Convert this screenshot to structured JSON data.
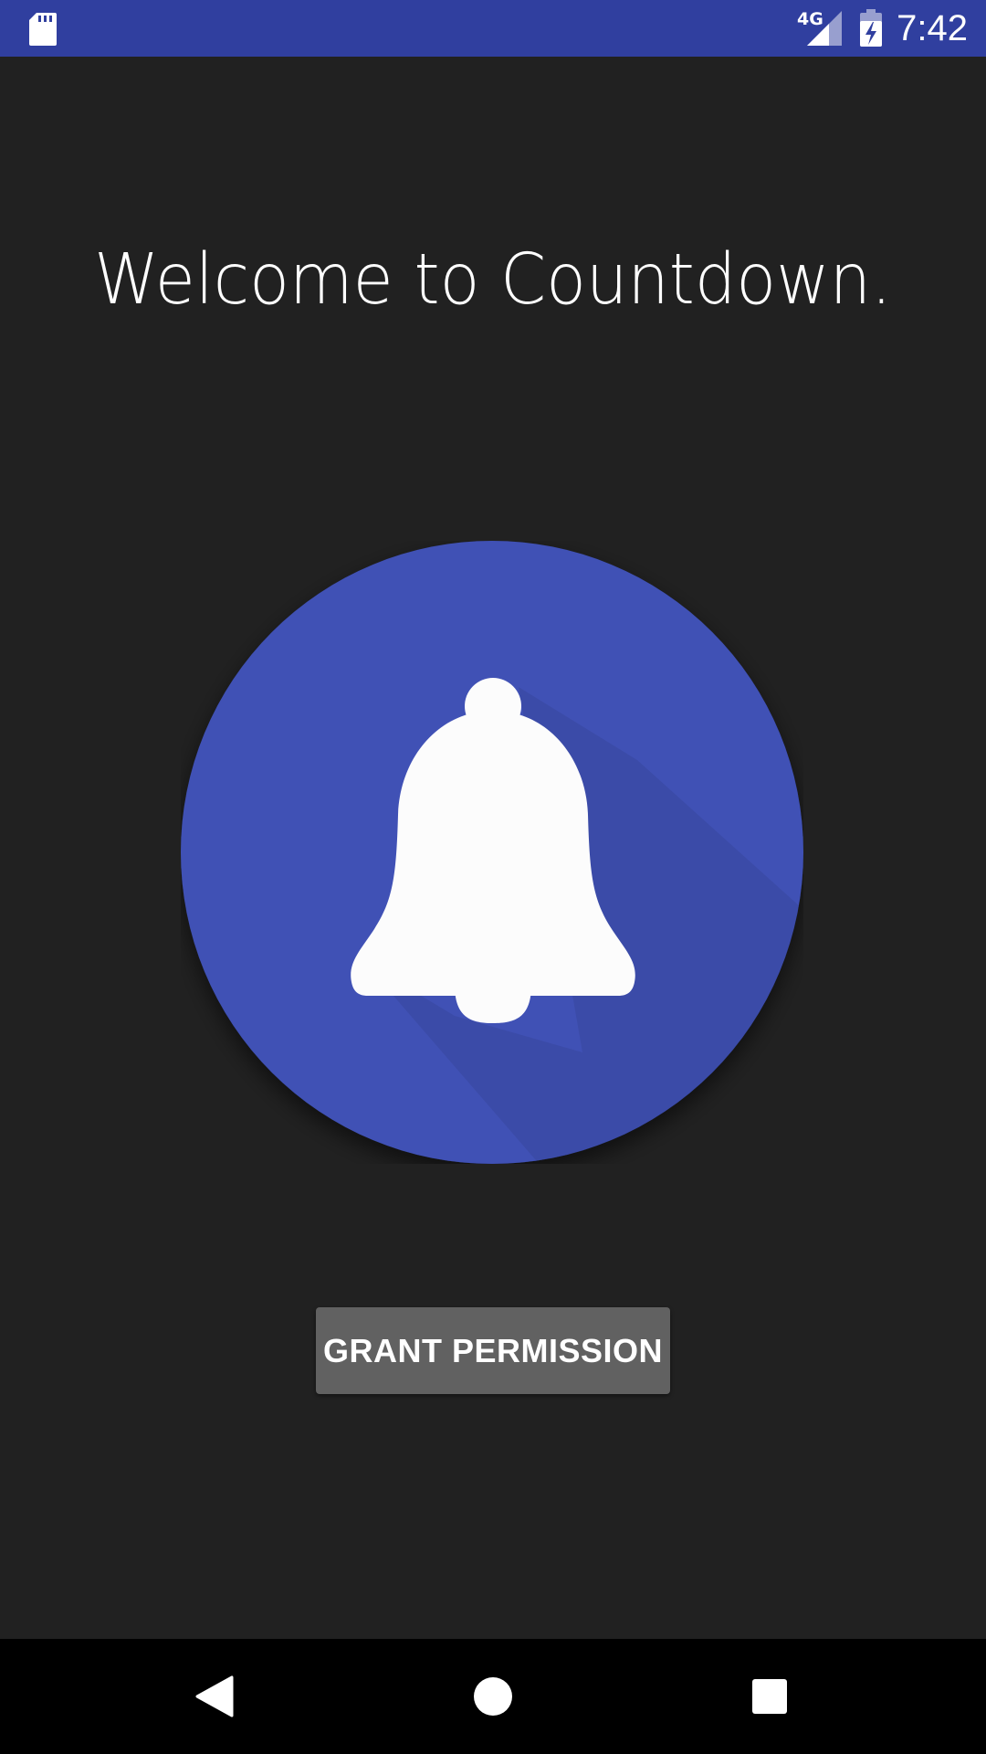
{
  "status_bar": {
    "network_type": "4G",
    "time": "7:42",
    "background_color": "#303f9f",
    "icons": [
      "sd-card-icon",
      "signal-icon",
      "battery-charging-icon"
    ]
  },
  "welcome": {
    "title": "Welcome to Countdown."
  },
  "hero": {
    "icon": "bell-icon",
    "circle_color": "#3f51b5"
  },
  "actions": {
    "grant_label": "GRANT PERMISSION"
  },
  "nav_bar": {
    "icons": [
      "back-icon",
      "home-icon",
      "recents-icon"
    ]
  },
  "colors": {
    "background": "#212121",
    "button": "#616161"
  }
}
